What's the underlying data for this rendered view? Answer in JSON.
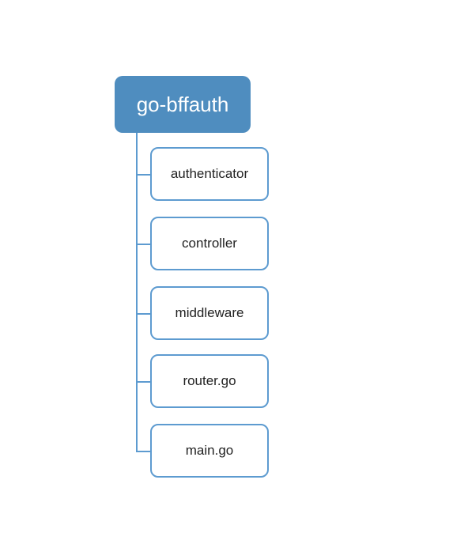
{
  "tree": {
    "root": {
      "label": "go-bffauth"
    },
    "children": [
      {
        "label": "authenticator"
      },
      {
        "label": "controller"
      },
      {
        "label": "middleware"
      },
      {
        "label": "router.go"
      },
      {
        "label": "main.go"
      }
    ]
  },
  "layout": {
    "childLeft": 190,
    "childTops": [
      186,
      274,
      362,
      448,
      536
    ],
    "trunkLeft": 172,
    "trunkTop": 168,
    "trunkBottom": 570,
    "branchLeft": 172,
    "branchRight": 190
  },
  "colors": {
    "accent": "#4f8dbf",
    "border": "#5d9bd0",
    "rootText": "#ffffff",
    "childText": "#222222"
  }
}
